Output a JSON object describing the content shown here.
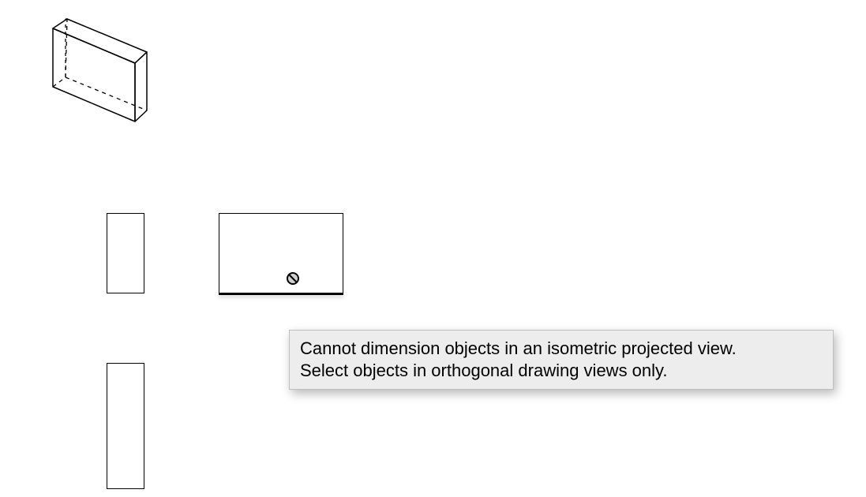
{
  "tooltip": {
    "line1": "Cannot dimension objects in an isometric projected view.",
    "line2": "Select objects in orthogonal drawing views only."
  },
  "views": {
    "isometric": {
      "name": "isometric-box-view"
    },
    "ortho_side_a": {
      "name": "side-view-a"
    },
    "ortho_front": {
      "name": "front-view"
    },
    "ortho_side_b": {
      "name": "side-view-b"
    }
  },
  "cursor": {
    "state": "not-allowed"
  }
}
